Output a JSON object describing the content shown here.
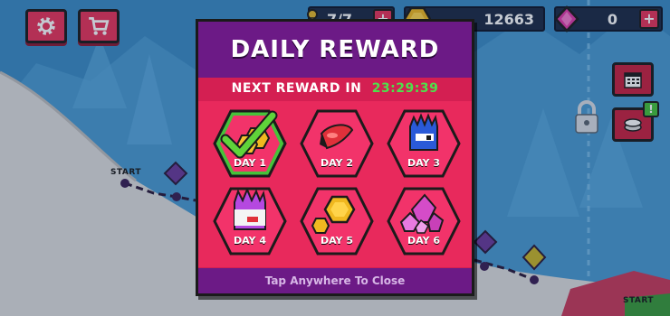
{
  "hud": {
    "keys": "7/7",
    "coins": "12663",
    "gems": "0",
    "plus": "+",
    "badge": "!"
  },
  "track": {
    "start_label_left": "START",
    "start_label_right": "START"
  },
  "modal": {
    "title": "DAILY REWARD",
    "next_reward_label": "NEXT REWARD IN",
    "next_reward_timer": "23:29:39",
    "close_hint": "Tap Anywhere To Close",
    "days": [
      {
        "label": "DAY 1",
        "reward_icon": "coin-pack-icon",
        "claimed": true
      },
      {
        "label": "DAY 2",
        "reward_icon": "red-hat-icon",
        "claimed": false
      },
      {
        "label": "DAY 3",
        "reward_icon": "blue-spiky-character-icon",
        "claimed": false
      },
      {
        "label": "DAY 4",
        "reward_icon": "purple-spiky-character-icon",
        "claimed": false
      },
      {
        "label": "DAY 5",
        "reward_icon": "gold-coins-icon",
        "claimed": false
      },
      {
        "label": "DAY 6",
        "reward_icon": "pink-gems-icon",
        "claimed": false
      }
    ]
  },
  "colors": {
    "accent_red": "#e8335a",
    "panel_purple": "#6c1a86",
    "timer_green": "#4fe04b",
    "claimed_green": "#46c23a"
  }
}
